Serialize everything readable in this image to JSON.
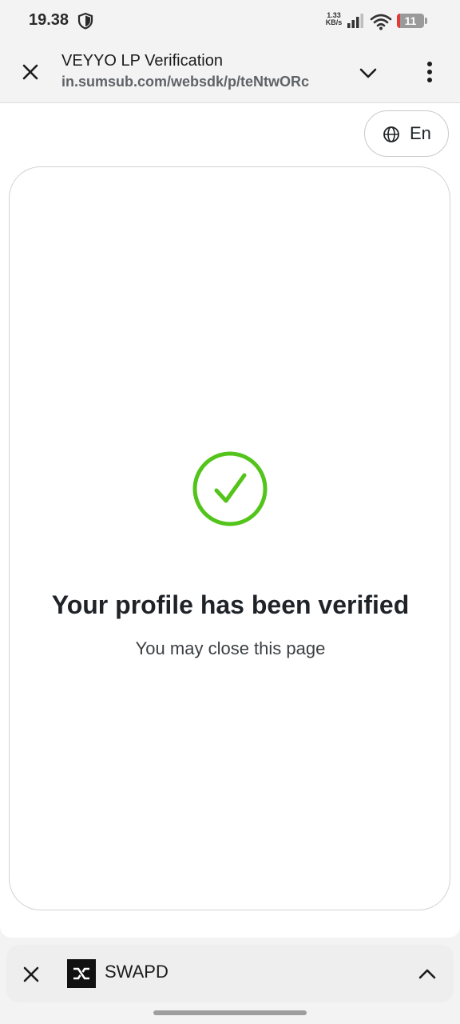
{
  "status_bar": {
    "time": "19.38",
    "net_speed_value": "1.33",
    "net_speed_unit": "KB/s",
    "battery_level": "11",
    "battery_fraction": 0.11,
    "battery_color": "#e53935"
  },
  "toolbar": {
    "title": "VEYYO LP Verification",
    "url": "in.sumsub.com/websdk/p/teNtwORc"
  },
  "page": {
    "language_label": "En",
    "success_color": "#52c41a",
    "title": "Your profile has been verified",
    "subtitle": "You may close this page"
  },
  "bottom_bar": {
    "app_name": "SWAPD"
  },
  "icons": {
    "status": [
      "shield-icon",
      "signal-icon",
      "wifi-icon",
      "battery-icon"
    ],
    "toolbar": [
      "close-icon",
      "chevron-down-icon",
      "more-vert-icon"
    ],
    "page": [
      "globe-icon",
      "checkmark-circle-icon"
    ],
    "bottom": [
      "close-icon",
      "swapd-logo-icon",
      "chevron-up-icon"
    ]
  }
}
